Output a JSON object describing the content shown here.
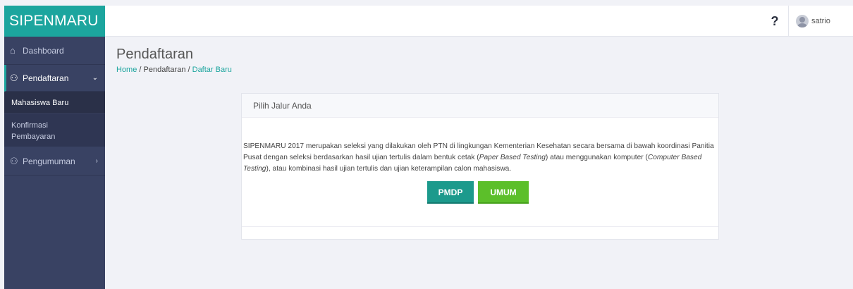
{
  "brand": "SIPENMARU",
  "sidebar": {
    "dashboard": "Dashboard",
    "pendaftaran": "Pendaftaran",
    "sub_mahasiswa": "Mahasiswa Baru",
    "sub_konfirmasi_1": "Konfirmasi",
    "sub_konfirmasi_2": "Pembayaran",
    "pengumuman": "Pengumuman"
  },
  "topbar": {
    "help": "?",
    "user": "satrio"
  },
  "header": {
    "title": "Pendaftaran",
    "crumb_home": "Home",
    "crumb_sep1": " / ",
    "crumb_pendaftaran": "Pendaftaran",
    "crumb_sep2": " / ",
    "crumb_current": "Daftar Baru"
  },
  "card": {
    "title": "Pilih Jalur Anda",
    "text_1": "SIPENMARU 2017 merupakan seleksi yang dilakukan oleh  PTN di lingkungan Kementerian Kesehatan secara bersama di bawah koordinasi Panitia Pusat dengan seleksi berdasarkan hasil ujian tertulis dalam bentuk cetak (",
    "text_pbt": "Paper Based Testing",
    "text_2": ") atau menggunakan komputer (",
    "text_cbt": "Computer Based Testing",
    "text_3": "), atau kombinasi hasil ujian tertulis dan ujian keterampilan calon mahasiswa.",
    "btn_pmdp": "PMDP",
    "btn_umum": "UMUM"
  },
  "colors": {
    "brand": "#1ca59e",
    "sidebar": "#394263",
    "pmdp": "#1c9a8c",
    "umum": "#5cbf2a"
  }
}
